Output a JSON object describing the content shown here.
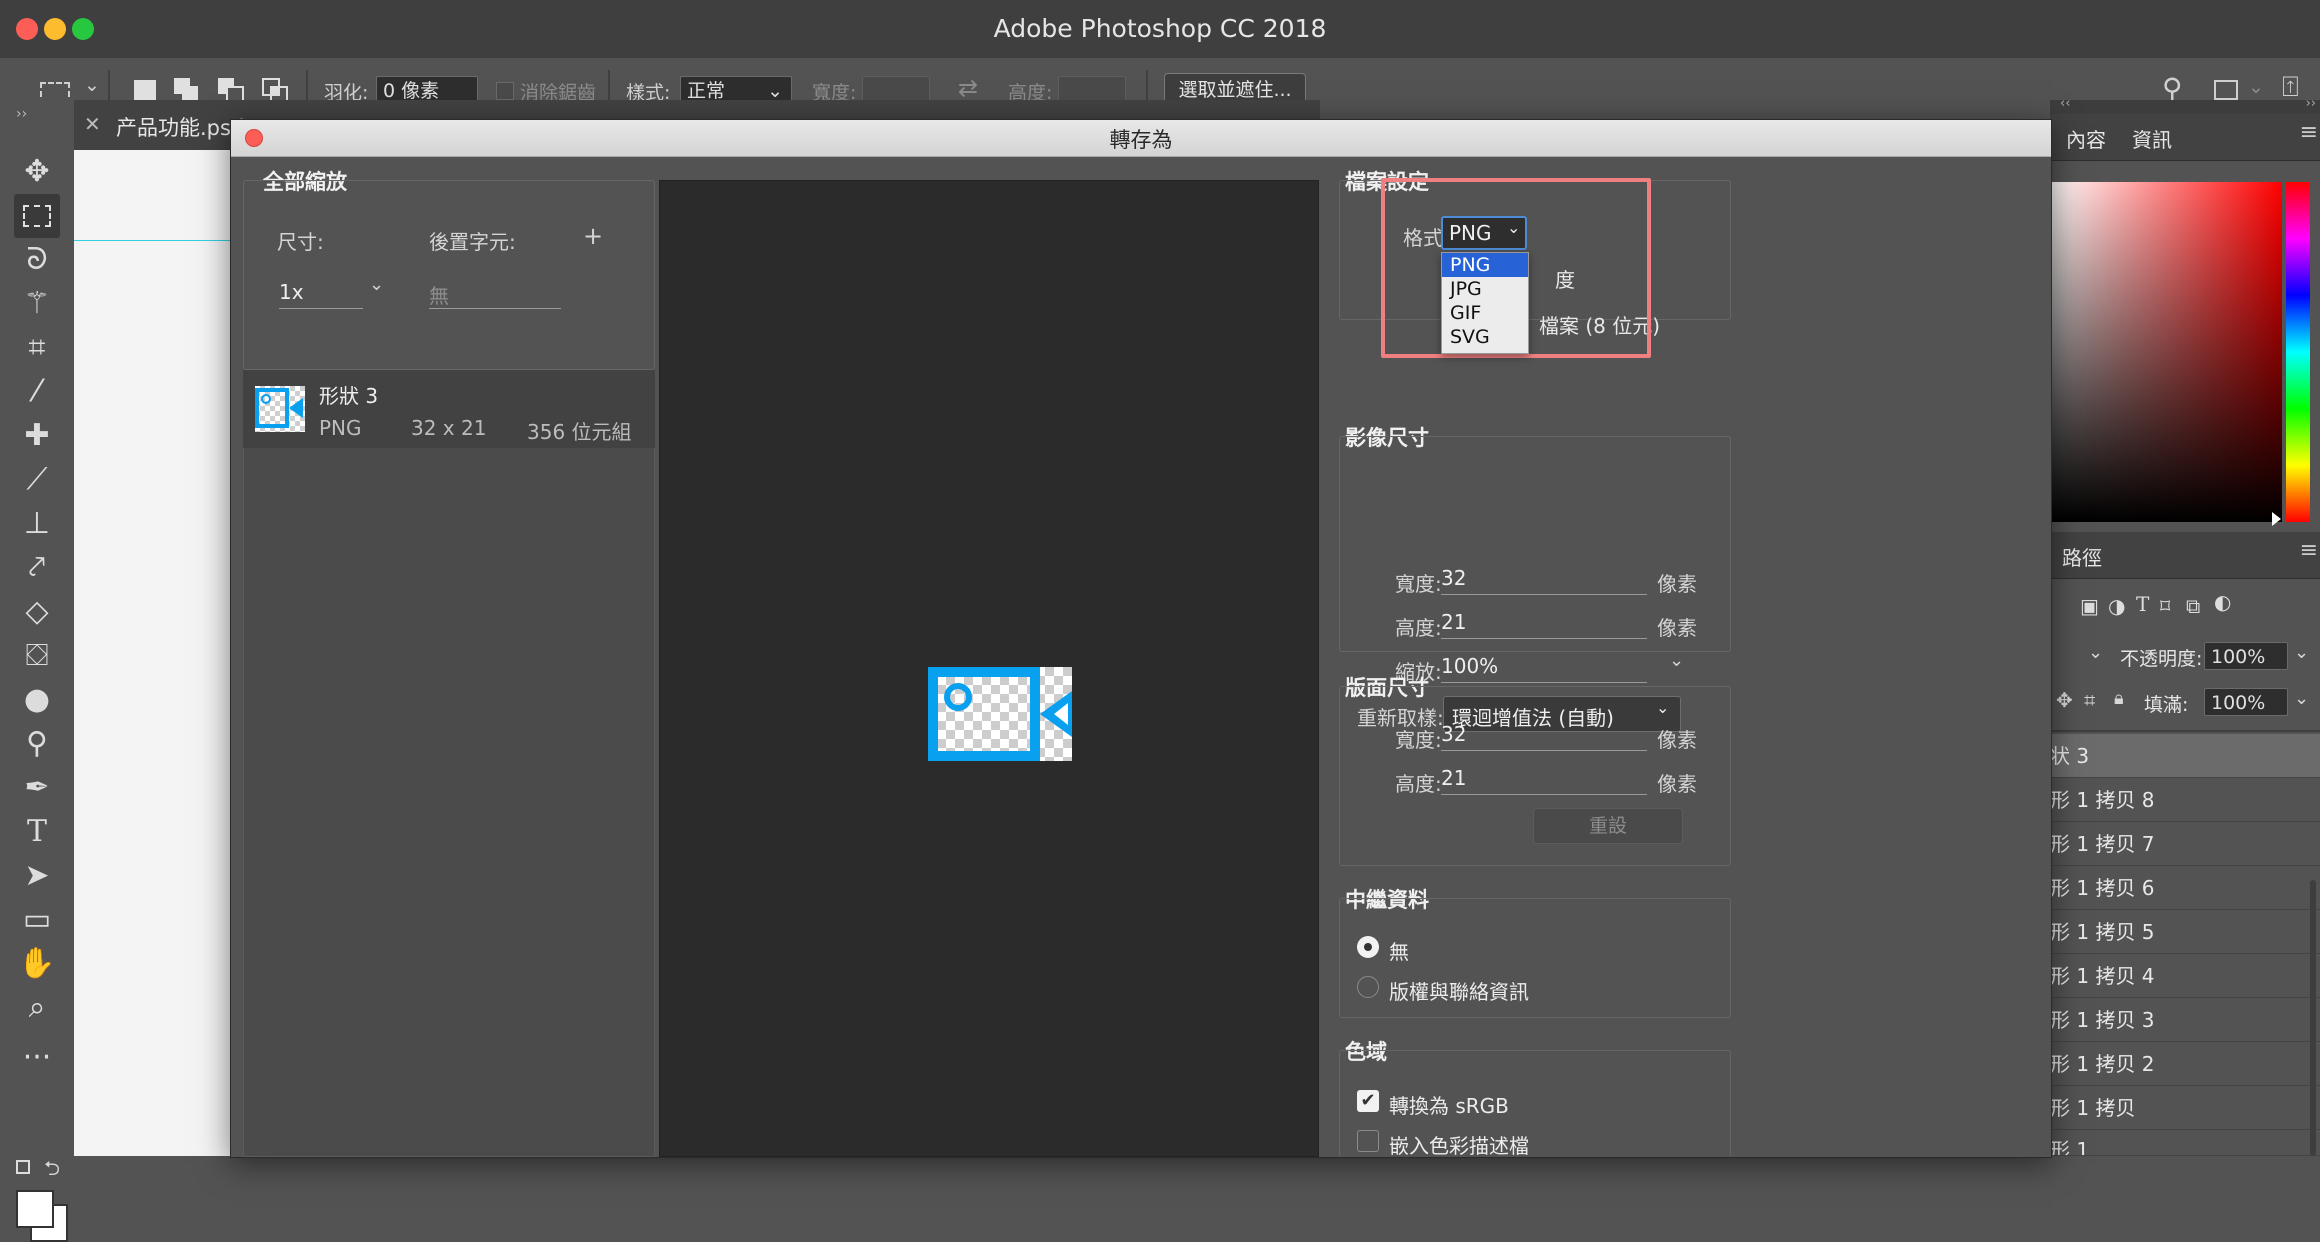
{
  "app": {
    "title": "Adobe Photoshop CC 2018",
    "colors": {
      "traffic_red": "#fc5e57",
      "traffic_yellow": "#fdbc2e",
      "traffic_green": "#27c840",
      "highlight": "#f08080",
      "accent_blue": "#0aa0f0",
      "select_blue": "#2762d6"
    }
  },
  "options_bar": {
    "feather_label": "羽化:",
    "feather_value": "0 像素",
    "antialias_label": "消除鋸齒",
    "style_label": "樣式:",
    "style_value": "正常",
    "width_label": "寬度:",
    "height_label": "高度:",
    "select_mask_button": "選取並遮住..."
  },
  "document_tab": {
    "label": "产品功能.psd"
  },
  "dialog": {
    "title": "轉存為",
    "scale_all": {
      "title": "全部縮放",
      "size_label": "尺寸:",
      "suffix_label": "後置字元:",
      "add_label": "+",
      "size_value": "1x",
      "suffix_placeholder": "無"
    },
    "asset": {
      "name": "形狀 3",
      "format": "PNG",
      "dimensions": "32 x 21",
      "filesize": "356 位元組"
    },
    "file_settings": {
      "title": "檔案設定",
      "format_label": "格式:",
      "format_value": "PNG",
      "format_options": [
        "PNG",
        "JPG",
        "GIF",
        "SVG"
      ],
      "partial_text_1": "度",
      "partial_text_2": "檔案 (8 位元)"
    },
    "image_size": {
      "title": "影像尺寸",
      "width_label": "寬度:",
      "width_value": "32",
      "height_label": "高度:",
      "height_value": "21",
      "scale_label": "縮放:",
      "scale_value": "100%",
      "resample_label": "重新取樣:",
      "resample_value": "環迴增值法 (自動)",
      "unit": "像素"
    },
    "canvas_size": {
      "title": "版面尺寸",
      "width_label": "寬度:",
      "width_value": "32",
      "height_label": "高度:",
      "height_value": "21",
      "unit": "像素",
      "reset_button": "重設"
    },
    "metadata": {
      "title": "中繼資料",
      "option_none": "無",
      "option_copyright": "版權與聯絡資訊"
    },
    "color_space": {
      "title": "色域",
      "convert_srgb": "轉換為 sRGB",
      "embed_profile": "嵌入色彩描述檔"
    }
  },
  "right_panels": {
    "tabs_top": [
      "內容",
      "資訊"
    ],
    "tab_paths": "路徑",
    "opacity_label": "不透明度:",
    "opacity_value": "100%",
    "fill_label": "填滿:",
    "fill_value": "100%",
    "layers": [
      "状 3",
      "形 1 拷贝 8",
      "形 1 拷贝 7",
      "形 1 拷贝 6",
      "形 1 拷贝 5",
      "形 1 拷贝 4",
      "形 1 拷贝 3",
      "形 1 拷贝 2",
      "形 1 拷贝",
      "形 1"
    ]
  }
}
